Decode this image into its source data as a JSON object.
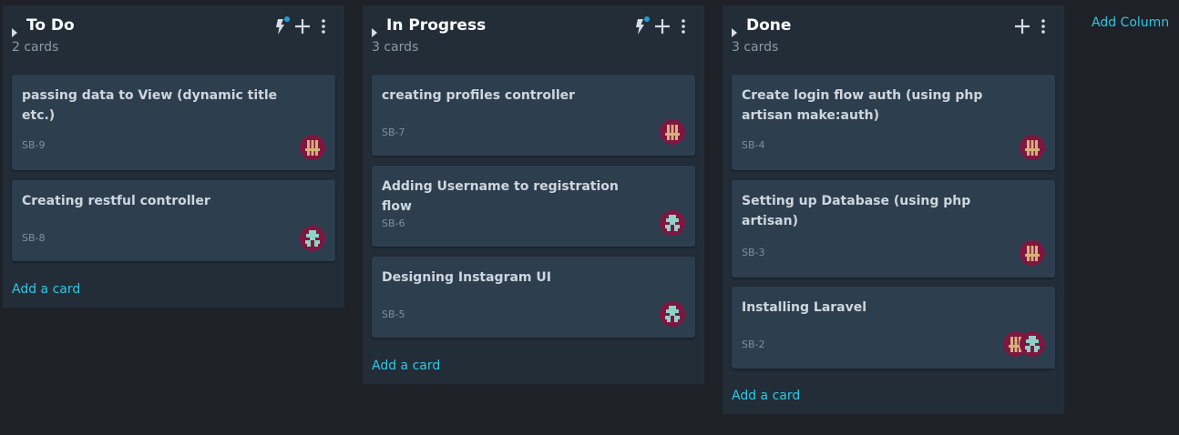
{
  "board": {
    "add_column_label": "Add Column",
    "add_card_label": "Add a card",
    "accent_color": "#2ec8e3",
    "columns": [
      {
        "title": "To Do",
        "count": "2 cards",
        "icons": [
          "lightning-icon",
          "plus-icon",
          "more-vert-icon"
        ],
        "cards": [
          {
            "title": "passing data to View (dynamic title etc.)",
            "key": "SB-9",
            "avatars": [
              "avatar-pattern-a"
            ]
          },
          {
            "title": "Creating restful controller",
            "key": "SB-8",
            "avatars": [
              "avatar-pattern-b"
            ]
          }
        ]
      },
      {
        "title": "In Progress",
        "count": "3 cards",
        "icons": [
          "lightning-icon",
          "plus-icon",
          "more-vert-icon"
        ],
        "cards": [
          {
            "title": "creating profiles controller",
            "key": "SB-7",
            "avatars": [
              "avatar-pattern-a"
            ]
          },
          {
            "title": "Adding Username to registration flow",
            "key": "SB-6",
            "avatars": [
              "avatar-pattern-b"
            ]
          },
          {
            "title": "Designing Instagram UI",
            "key": "SB-5",
            "avatars": [
              "avatar-pattern-b"
            ]
          }
        ]
      },
      {
        "title": "Done",
        "count": "3 cards",
        "icons": [
          "plus-icon",
          "more-vert-icon"
        ],
        "cards": [
          {
            "title": "Create login flow auth (using php artisan make:auth)",
            "key": "SB-4",
            "avatars": [
              "avatar-pattern-a"
            ]
          },
          {
            "title": "Setting up Database (using php artisan)",
            "key": "SB-3",
            "avatars": [
              "avatar-pattern-a"
            ]
          },
          {
            "title": "Installing Laravel",
            "key": "SB-2",
            "avatars": [
              "avatar-pattern-a",
              "avatar-pattern-b"
            ]
          }
        ]
      }
    ]
  }
}
